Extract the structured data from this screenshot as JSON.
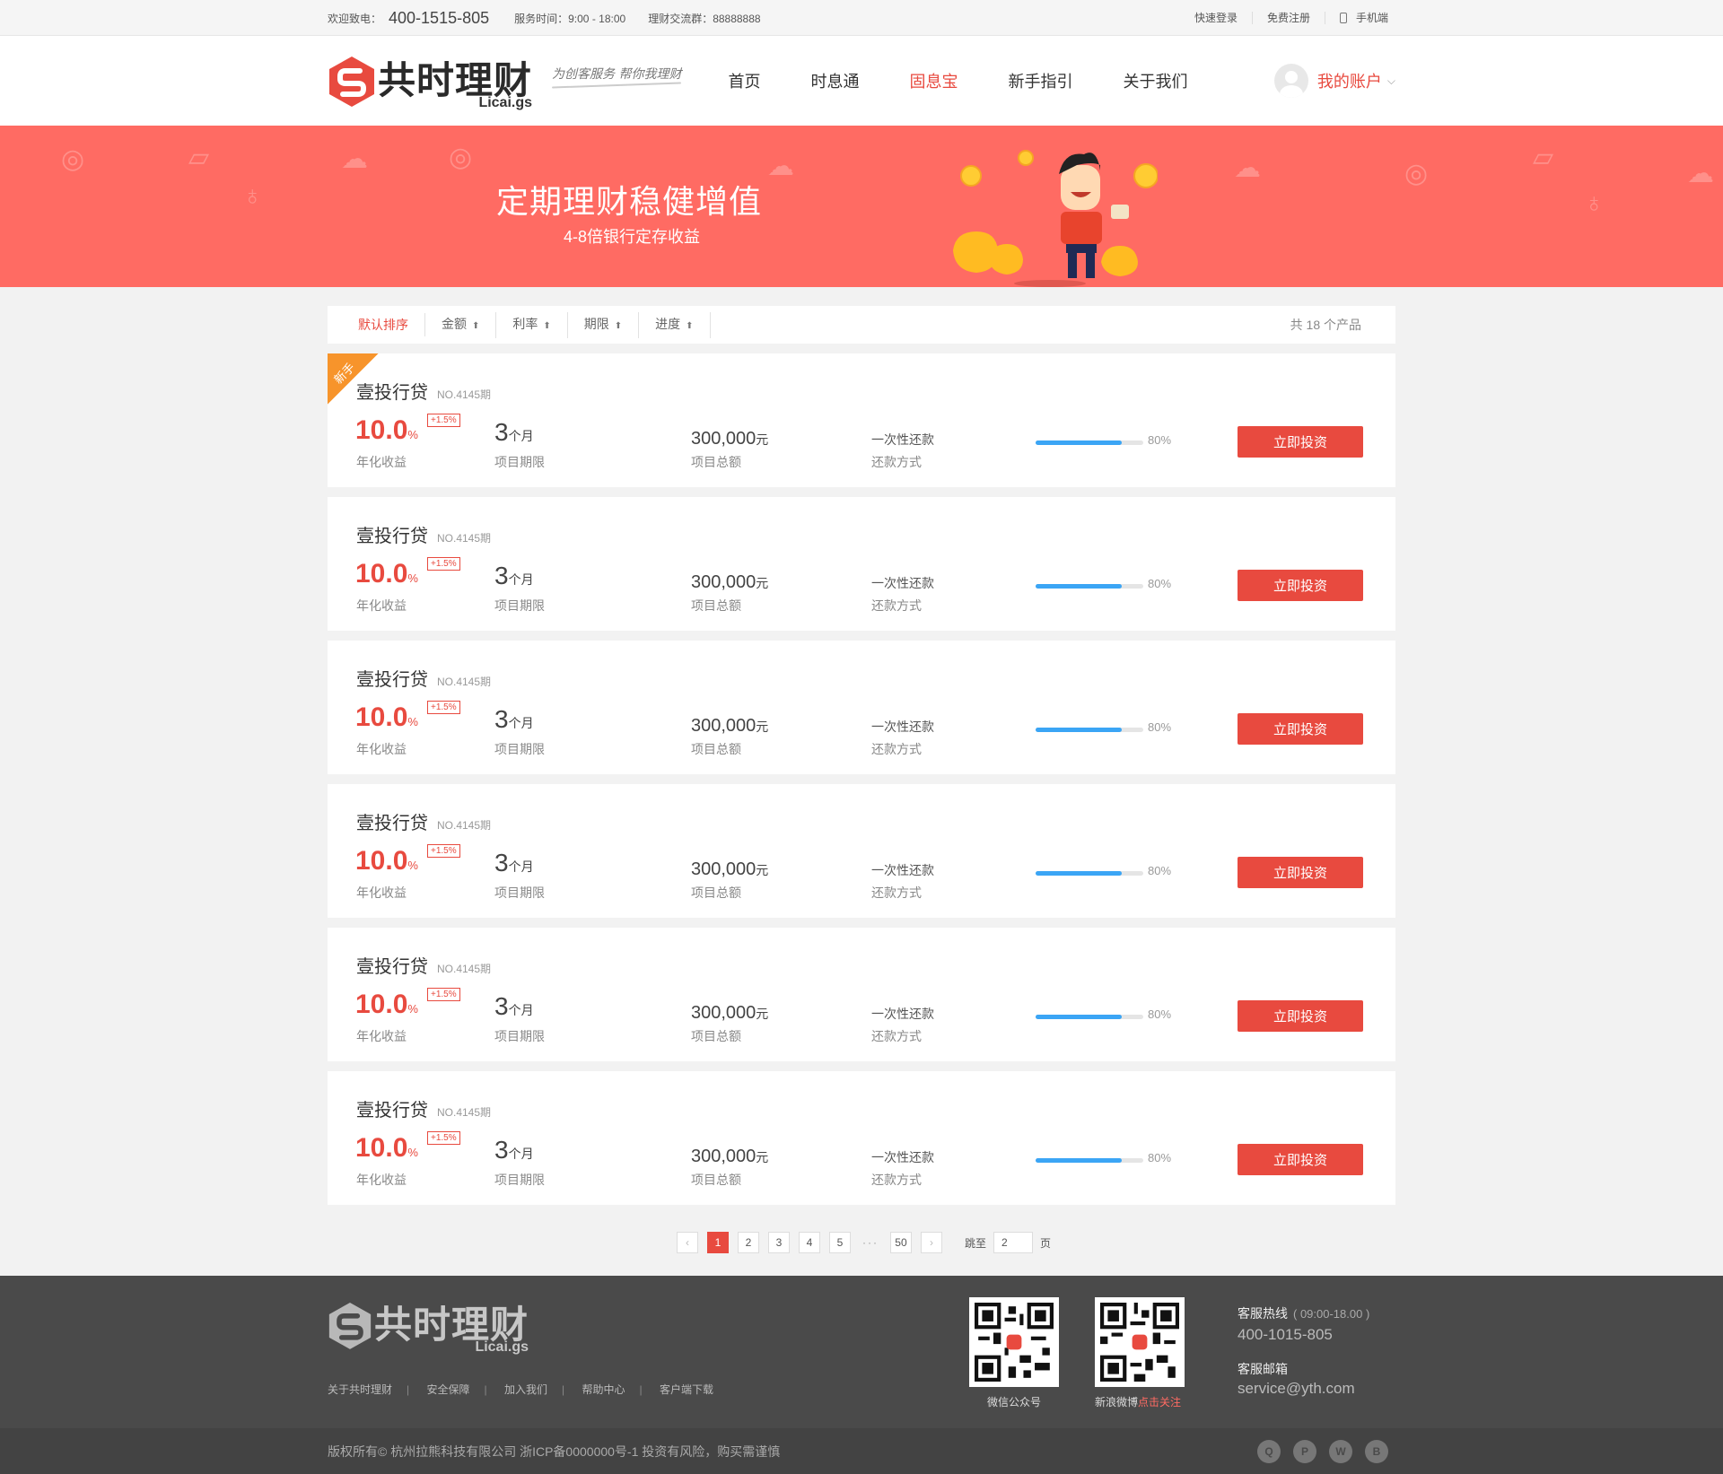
{
  "topbar": {
    "welcome": "欢迎致电：",
    "phone": "400-1515-805",
    "service_hours": "服务时间：9:00 - 18:00",
    "group": "理财交流群：88888888",
    "quick_login": "快速登录",
    "register": "免费注册",
    "mobile": "手机端"
  },
  "header": {
    "logo_cn": "共时理财",
    "logo_en": "Licai.gs",
    "slogan": "为创客服务 帮你我理财",
    "nav": [
      "首页",
      "时息通",
      "固息宝",
      "新手指引",
      "关于我们"
    ],
    "active_nav": "固息宝",
    "account": "我的账户"
  },
  "banner": {
    "title": "定期理财稳健增值",
    "subtitle": "4-8倍银行定存收益"
  },
  "sortbar": {
    "items": [
      "默认排序",
      "金额",
      "利率",
      "期限",
      "进度"
    ],
    "total": "共 18 个产品"
  },
  "product_labels": {
    "rate_label": "年化收益",
    "term_label": "项目期限",
    "amount_label": "项目总额",
    "repay_label": "还款方式",
    "button": "立即投资",
    "new_tag": "新手"
  },
  "products": [
    {
      "name": "壹投行贷",
      "no": "NO.4145期",
      "rate": "10.0",
      "rate_unit": "%",
      "bonus": "+1.5%",
      "term": "3",
      "term_unit": "个月",
      "amount": "300,000",
      "amount_unit": "元",
      "repay": "一次性还款",
      "progress": 0.8,
      "progress_text": "80%",
      "is_new": true
    },
    {
      "name": "壹投行贷",
      "no": "NO.4145期",
      "rate": "10.0",
      "rate_unit": "%",
      "bonus": "+1.5%",
      "term": "3",
      "term_unit": "个月",
      "amount": "300,000",
      "amount_unit": "元",
      "repay": "一次性还款",
      "progress": 0.8,
      "progress_text": "80%",
      "is_new": false
    },
    {
      "name": "壹投行贷",
      "no": "NO.4145期",
      "rate": "10.0",
      "rate_unit": "%",
      "bonus": "+1.5%",
      "term": "3",
      "term_unit": "个月",
      "amount": "300,000",
      "amount_unit": "元",
      "repay": "一次性还款",
      "progress": 0.8,
      "progress_text": "80%",
      "is_new": false
    },
    {
      "name": "壹投行贷",
      "no": "NO.4145期",
      "rate": "10.0",
      "rate_unit": "%",
      "bonus": "+1.5%",
      "term": "3",
      "term_unit": "个月",
      "amount": "300,000",
      "amount_unit": "元",
      "repay": "一次性还款",
      "progress": 0.8,
      "progress_text": "80%",
      "is_new": false
    },
    {
      "name": "壹投行贷",
      "no": "NO.4145期",
      "rate": "10.0",
      "rate_unit": "%",
      "bonus": "+1.5%",
      "term": "3",
      "term_unit": "个月",
      "amount": "300,000",
      "amount_unit": "元",
      "repay": "一次性还款",
      "progress": 0.8,
      "progress_text": "80%",
      "is_new": false
    },
    {
      "name": "壹投行贷",
      "no": "NO.4145期",
      "rate": "10.0",
      "rate_unit": "%",
      "bonus": "+1.5%",
      "term": "3",
      "term_unit": "个月",
      "amount": "300,000",
      "amount_unit": "元",
      "repay": "一次性还款",
      "progress": 0.8,
      "progress_text": "80%",
      "is_new": false
    }
  ],
  "pager": {
    "pages": [
      "1",
      "2",
      "3",
      "4",
      "5"
    ],
    "current": "1",
    "dots": "···",
    "last": "50",
    "jump_label": "跳至",
    "jump_value": "2",
    "page_label": "页"
  },
  "footer": {
    "logo_cn": "共时理财",
    "logo_en": "Licai.gs",
    "links": [
      "关于共时理财",
      "安全保障",
      "加入我们",
      "帮助中心",
      "客户端下载"
    ],
    "qr1_label": "微信公众号",
    "qr2_label": "新浪微博",
    "qr2_follow": "点击关注",
    "hotline_title": "客服热线",
    "hotline_hours": "( 09:00-18.00 )",
    "hotline": "400-1015-805",
    "email_title": "客服邮箱",
    "email": "service@yth.com",
    "copyright": "版权所有© 杭州拉熊科技有限公司  浙ICP备0000000号-1  投资有风险，购买需谨慎",
    "socials": [
      "qq-icon",
      "pinterest-icon",
      "wechat-icon",
      "weibo-icon"
    ]
  },
  "colors": {
    "brand_red": "#e84a3f",
    "banner": "#ff6b63",
    "progress": "#3ba5f5",
    "new_tag": "#f7942b"
  }
}
